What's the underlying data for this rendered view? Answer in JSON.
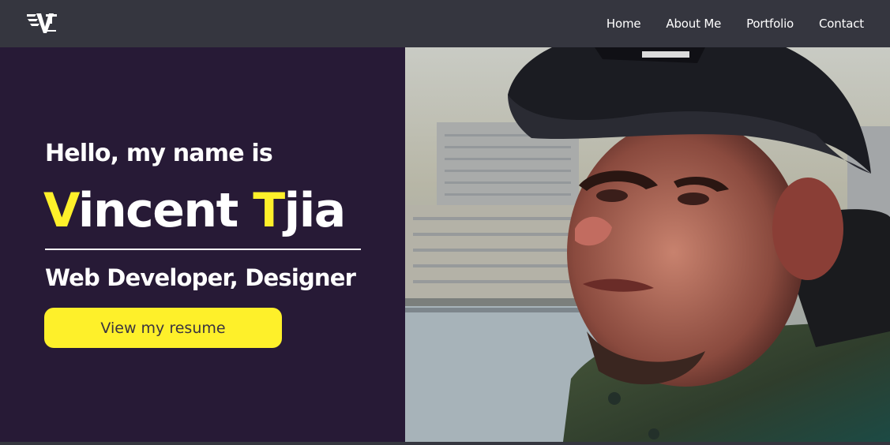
{
  "nav": {
    "logo_icon": "vt-monogram-logo",
    "links": [
      "Home",
      "About Me",
      "Portfolio",
      "Contact"
    ]
  },
  "hero": {
    "greeting": "Hello, my name is",
    "name": {
      "first_initial": "V",
      "first_rest": "incent",
      "last_initial": "T",
      "last_rest": "jia"
    },
    "role": "Web Developer, Designer",
    "cta_label": "View my resume",
    "photo_icon": "profile-photo"
  },
  "colors": {
    "nav_bg": "#35363f",
    "hero_bg": "#271a36",
    "accent": "#fef02a",
    "text": "#ffffff"
  }
}
